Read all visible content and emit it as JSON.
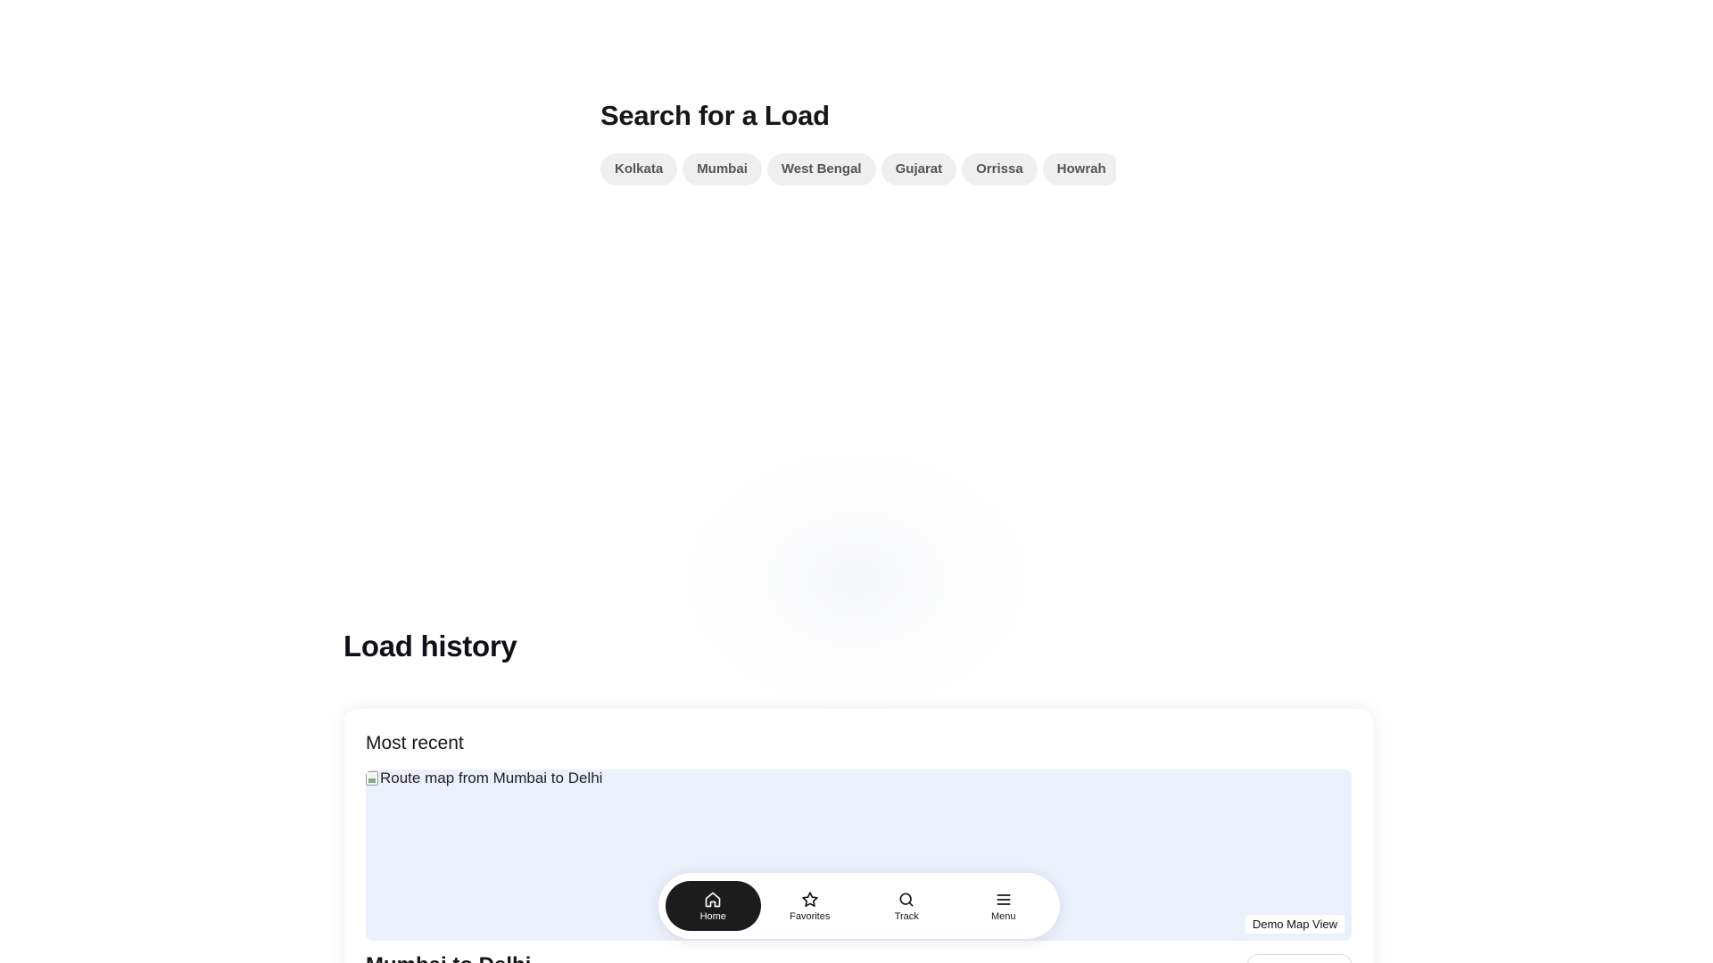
{
  "search": {
    "title": "Search for a Load",
    "chips": [
      "Kolkata",
      "Mumbai",
      "West Bengal",
      "Gujarat",
      "Orrissa",
      "Howrah"
    ]
  },
  "history": {
    "title": "Load history",
    "card": {
      "label": "Most recent",
      "map_alt": "Route map from Mumbai to Delhi",
      "map_badge": "Demo Map View",
      "route": "Mumbai to Delhi"
    }
  },
  "nav": {
    "items": [
      {
        "label": "Home",
        "icon": "home-icon",
        "active": true
      },
      {
        "label": "Favorites",
        "icon": "star-icon",
        "active": false
      },
      {
        "label": "Track",
        "icon": "search-icon",
        "active": false
      },
      {
        "label": "Menu",
        "icon": "menu-icon",
        "active": false
      }
    ]
  },
  "colors": {
    "map_bg": "#ebf0fc",
    "active_nav_bg": "#1c1c1c",
    "chip_bg": "#efefef"
  }
}
